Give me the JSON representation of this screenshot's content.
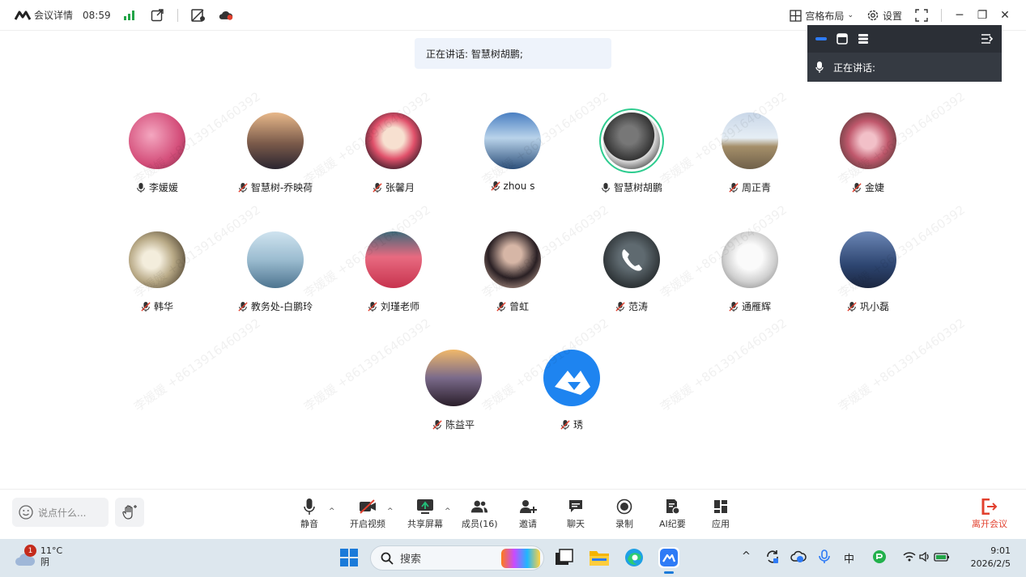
{
  "app": {
    "title": "会议详情",
    "time": "08:59"
  },
  "topbar": {
    "layout_label": "宫格布局",
    "settings_label": "设置"
  },
  "speaking": {
    "banner": "正在讲话: 智慧树胡鹏;",
    "mini_label": "正在讲话:"
  },
  "watermark": "李媛媛 +8613916460392",
  "participants": [
    {
      "name": "李媛媛",
      "muted": false
    },
    {
      "name": "智慧树-乔映荷",
      "muted": true
    },
    {
      "name": "张馨月",
      "muted": true
    },
    {
      "name": "zhou s",
      "muted": true
    },
    {
      "name": "智慧树胡鹏",
      "muted": false,
      "speaking": true
    },
    {
      "name": "周正青",
      "muted": true
    },
    {
      "name": "金婕",
      "muted": true
    },
    {
      "name": "韩华",
      "muted": true
    },
    {
      "name": "教务处-白鹏玲",
      "muted": true
    },
    {
      "name": "刘瑾老师",
      "muted": true
    },
    {
      "name": "曾虹",
      "muted": true
    },
    {
      "name": "范涛",
      "muted": true
    },
    {
      "name": "通雁辉",
      "muted": true
    },
    {
      "name": "巩小磊",
      "muted": true
    },
    {
      "name": "陈益平",
      "muted": true
    },
    {
      "name": "琇",
      "muted": true
    }
  ],
  "toolbar": {
    "say_placeholder": "说点什么...",
    "mute": "静音",
    "video": "开启视频",
    "share": "共享屏幕",
    "members": "成员(16)",
    "invite": "邀请",
    "chat": "聊天",
    "record": "录制",
    "ai": "AI纪要",
    "apps": "应用",
    "leave": "离开会议"
  },
  "taskbar": {
    "weather_temp": "11°C",
    "weather_desc": "阴",
    "weather_badge": "1",
    "search_placeholder": "搜索",
    "ime": "中",
    "clock_time": "9:01",
    "clock_date": "2026/2/5"
  },
  "colors": {
    "accent": "#2e7bf6",
    "speaking_ring": "#2ecc8f",
    "leave": "#e2402e",
    "signal": "#22a447"
  }
}
